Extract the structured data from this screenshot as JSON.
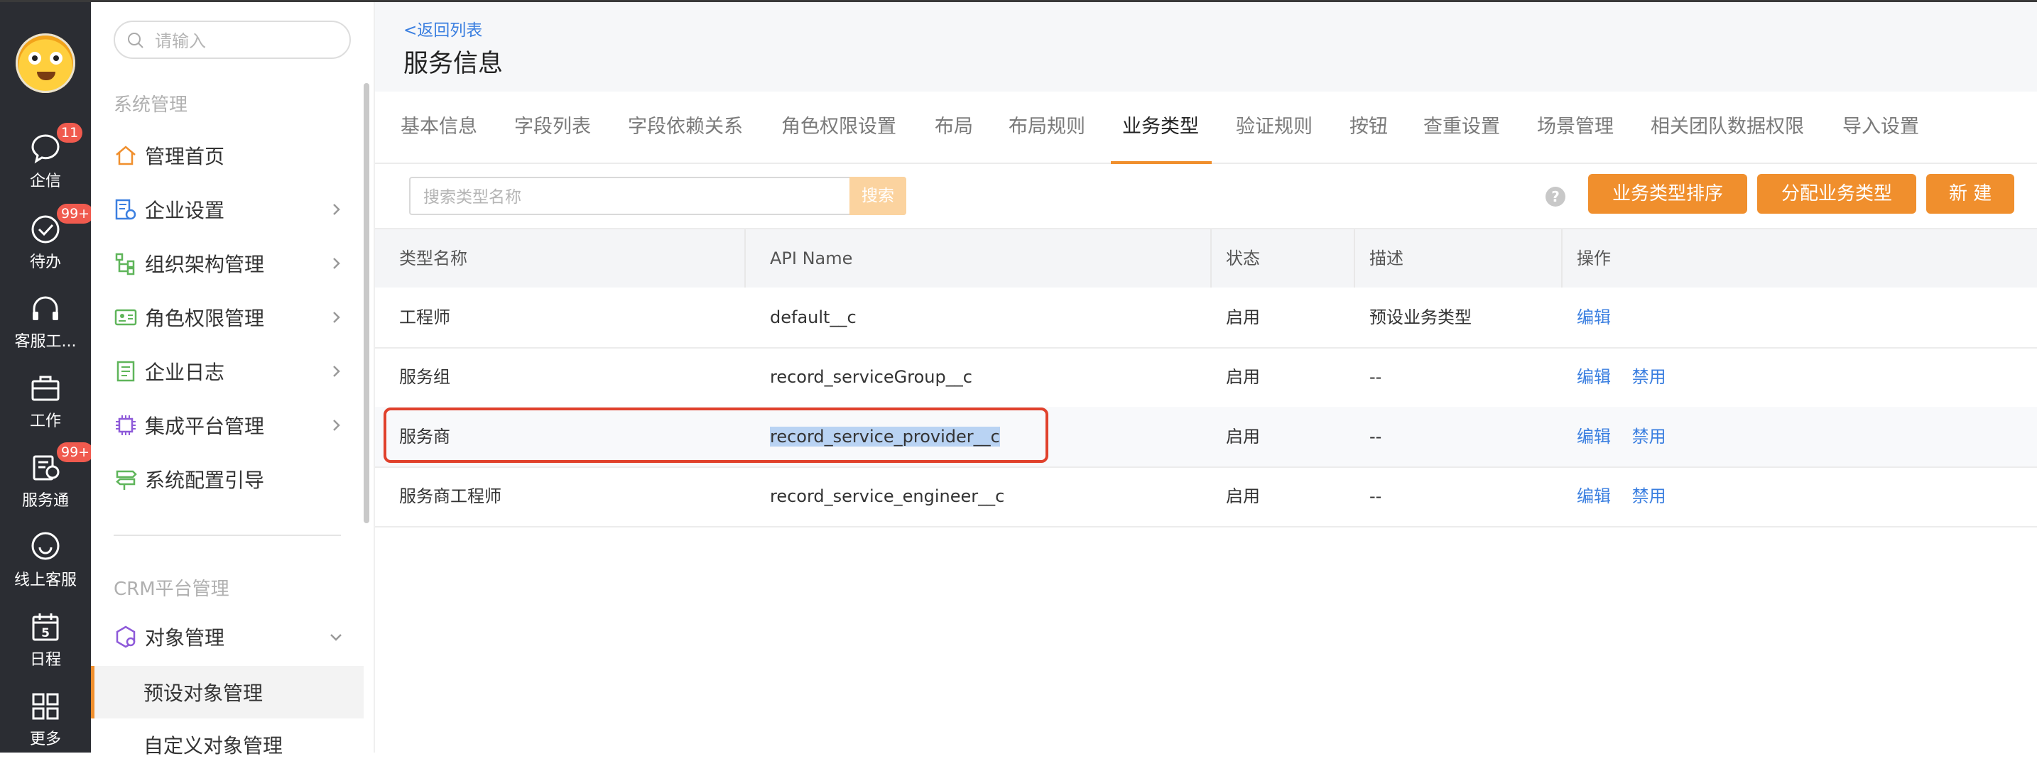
{
  "rail": {
    "items": [
      {
        "label": "企信",
        "icon": "chat-icon",
        "badge": "11"
      },
      {
        "label": "待办",
        "icon": "check-circle-icon",
        "badge": "99+"
      },
      {
        "label": "客服工...",
        "icon": "headset-icon",
        "badge": ""
      },
      {
        "label": "工作",
        "icon": "briefcase-icon",
        "badge": ""
      },
      {
        "label": "服务通",
        "icon": "service-doc-icon",
        "badge": "99+"
      },
      {
        "label": "线上客服",
        "icon": "smile-chat-icon",
        "badge": ""
      },
      {
        "label": "日程",
        "icon": "calendar-icon",
        "badge": "",
        "calendar_day": "5"
      },
      {
        "label": "更多",
        "icon": "grid-icon",
        "badge": ""
      }
    ]
  },
  "sidebar": {
    "search_placeholder": "请输入",
    "section1": "系统管理",
    "items": [
      {
        "label": "管理首页",
        "icon": "home-icon"
      },
      {
        "label": "企业设置",
        "icon": "company-settings-icon"
      },
      {
        "label": "组织架构管理",
        "icon": "org-tree-icon"
      },
      {
        "label": "角色权限管理",
        "icon": "id-card-icon"
      },
      {
        "label": "企业日志",
        "icon": "log-icon"
      },
      {
        "label": "集成平台管理",
        "icon": "chip-icon"
      },
      {
        "label": "系统配置引导",
        "icon": "signpost-icon"
      }
    ],
    "section2": "CRM平台管理",
    "object_mgmt": {
      "label": "对象管理",
      "icon": "cube-gear-icon"
    },
    "sub_items": [
      "预设对象管理",
      "自定义对象管理"
    ]
  },
  "main": {
    "back_link": "<返回列表",
    "title": "服务信息",
    "tabs": [
      "基本信息",
      "字段列表",
      "字段依赖关系",
      "角色权限设置",
      "布局",
      "布局规则",
      "业务类型",
      "验证规则",
      "按钮",
      "查重设置",
      "场景管理",
      "相关团队数据权限",
      "导入设置"
    ],
    "active_tab": "业务类型",
    "search_placeholder": "搜索类型名称",
    "search_button": "搜索",
    "buttons": [
      "业务类型排序",
      "分配业务类型",
      "新 建"
    ],
    "help": "?",
    "table": {
      "headers": [
        "类型名称",
        "API Name",
        "状态",
        "描述",
        "操作"
      ],
      "rows": [
        {
          "name": "工程师",
          "api": "default__c",
          "status": "启用",
          "desc": "预设业务类型",
          "ops": [
            "编辑"
          ]
        },
        {
          "name": "服务组",
          "api": "record_serviceGroup__c",
          "status": "启用",
          "desc": "--",
          "ops": [
            "编辑",
            "禁用"
          ]
        },
        {
          "name": "服务商",
          "api": "record_service_provider__c",
          "status": "启用",
          "desc": "--",
          "ops": [
            "编辑",
            "禁用"
          ]
        },
        {
          "name": "服务商工程师",
          "api": "record_service_engineer__c",
          "status": "启用",
          "desc": "--",
          "ops": [
            "编辑",
            "禁用"
          ]
        }
      ]
    }
  },
  "colors": {
    "accent": "#f08f2d",
    "link": "#3b7fe0",
    "rail_bg": "#2b2d33",
    "badge": "#f05a4e",
    "highlight": "#e0412c"
  }
}
